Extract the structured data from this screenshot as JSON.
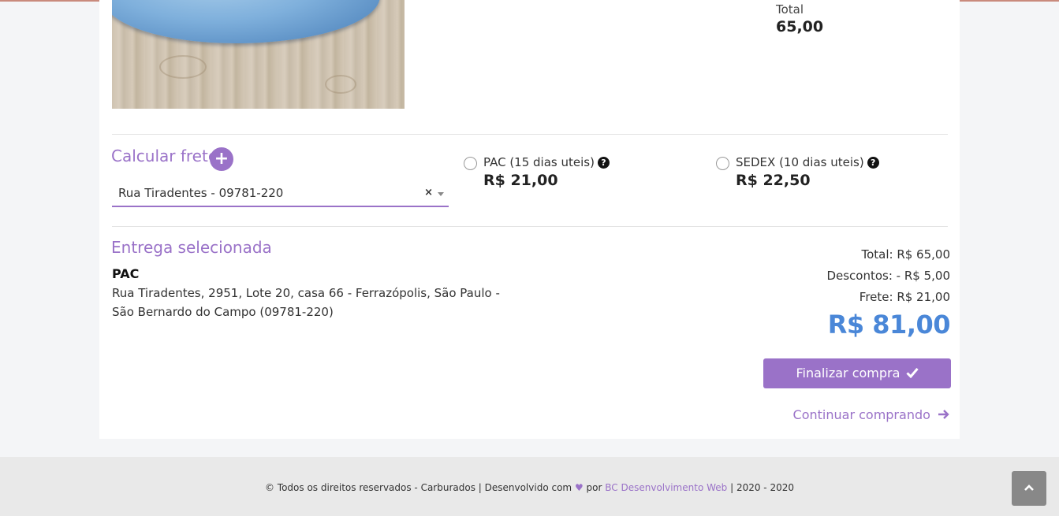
{
  "product": {
    "total_label": "Total",
    "total_value": "65,00"
  },
  "frete": {
    "title": "Calcular frete",
    "add_icon": "+",
    "address_selected": "Rua Tiradentes - 09781-220",
    "clear_icon": "×"
  },
  "shipping_options": [
    {
      "name": "PAC (15 dias uteis)",
      "price": "R$ 21,00",
      "selected": false
    },
    {
      "name": "SEDEX (10 dias uteis)",
      "price": "R$ 22,50",
      "selected": false
    }
  ],
  "entrega": {
    "title": "Entrega selecionada",
    "method": "PAC",
    "address": "Rua Tiradentes, 2951, Lote 20, casa 66 - Ferrazópolis, São Paulo - São Bernardo do Campo (09781-220)"
  },
  "summary": {
    "total": "Total: R$ 65,00",
    "descontos": "Descontos: - R$ 5,00",
    "frete": "Frete: R$ 21,00",
    "grand_total": "R$ 81,00"
  },
  "actions": {
    "finalizar_label": "Finalizar compra",
    "continuar_label": "Continuar comprando"
  },
  "footer": {
    "text_before": "© Todos os direitos reservados - Carburados | Desenvolvido com",
    "text_por": "por",
    "link_text": "BC Desenvolvimento Web",
    "text_after": "| 2020 - 2020"
  },
  "colors": {
    "accent": "#9a72c8",
    "total_blue": "#4a87d8"
  },
  "icons": {
    "help": "help-icon",
    "check": "check-icon",
    "arrow_right": "arrow-right-icon",
    "heart": "heart-icon",
    "chevron_up": "chevron-up-icon"
  }
}
